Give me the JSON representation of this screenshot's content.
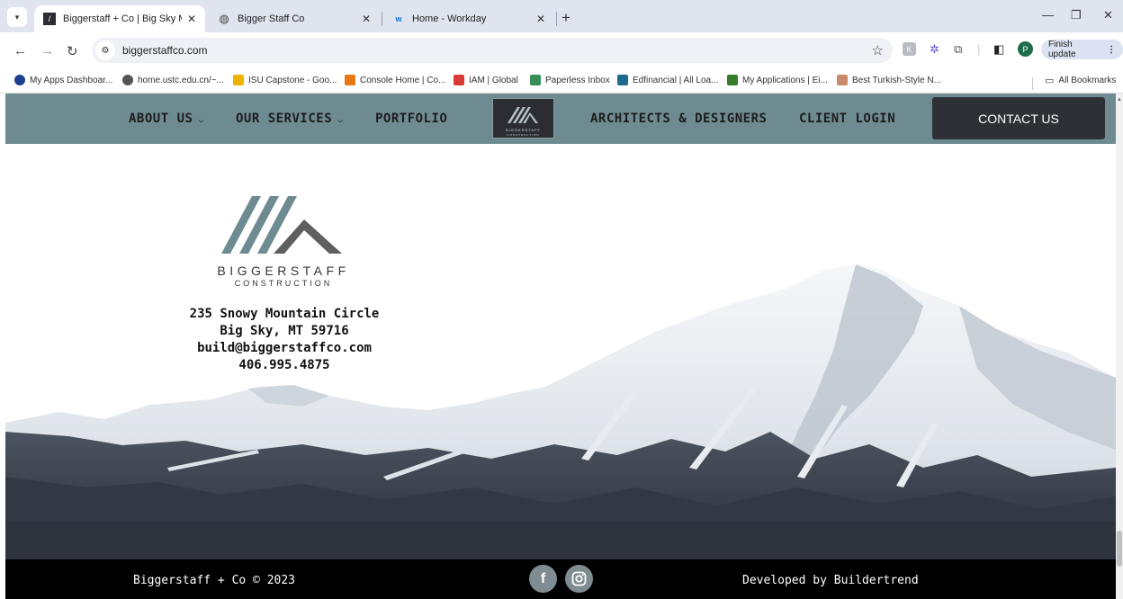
{
  "browser": {
    "tabs": [
      {
        "title": "Biggerstaff + Co | Big Sky Mont",
        "favicon": "biggerstaff-logo-icon",
        "active": true
      },
      {
        "title": "Bigger Staff Co",
        "favicon": "globe-icon",
        "active": false
      },
      {
        "title": "Home - Workday",
        "favicon": "workday-icon",
        "active": false
      }
    ],
    "new_tab_label": "+",
    "url": "biggerstaffco.com",
    "finish_update_label": "Finish update",
    "profile_initial": "P",
    "extension_label": "K",
    "bookmarks": [
      {
        "label": "My Apps Dashboar...",
        "icon": "okta-icon",
        "color": "#1d3f8f"
      },
      {
        "label": "home.ustc.edu.cn/~...",
        "icon": "globe-icon",
        "color": "#555555"
      },
      {
        "label": "ISU Capstone - Goo...",
        "icon": "drive-icon",
        "color": "#f2b300"
      },
      {
        "label": "Console Home | Co...",
        "icon": "aws-icon",
        "color": "#e57a12"
      },
      {
        "label": "IAM | Global",
        "icon": "iam-icon",
        "color": "#d93a35"
      },
      {
        "label": "Paperless Inbox",
        "icon": "paperless-icon",
        "color": "#3a8d5b"
      },
      {
        "label": "Edfinancial | All Loa...",
        "icon": "edfinancial-icon",
        "color": "#1c6a8e"
      },
      {
        "label": "My Applications | Ei...",
        "icon": "deere-icon",
        "color": "#367c2b"
      },
      {
        "label": "Best Turkish-Style N...",
        "icon": "recipe-icon",
        "color": "#c98a6a"
      }
    ],
    "all_bookmarks_label": "All Bookmarks"
  },
  "site": {
    "nav": {
      "about": "ABOUT US",
      "services": "OUR SERVICES",
      "portfolio": "PORTFOLIO",
      "logo_text": "BIGGERSTAFF",
      "logo_sub": "CONSTRUCTION",
      "architects": "ARCHITECTS & DESIGNERS",
      "client_login": "CLIENT LOGIN",
      "contact": "CONTACT US"
    },
    "brand": {
      "name": "BIGGERSTAFF",
      "sub": "CONSTRUCTION"
    },
    "address": {
      "street": "235 Snowy Mountain Circle",
      "city": "Big Sky, MT 59716",
      "email": "build@biggerstaffco.com",
      "phone": "406.995.4875"
    },
    "footer": {
      "copyright": "Biggerstaff + Co © 2023",
      "developed_by": "Developed by Buildertrend",
      "facebook": "f",
      "instagram": "instagram-icon"
    }
  },
  "colors": {
    "nav_bg": "#6f8b92",
    "contact_bg": "#2e3036",
    "footer_bg": "#000000",
    "social_bg": "#7f8c92"
  }
}
